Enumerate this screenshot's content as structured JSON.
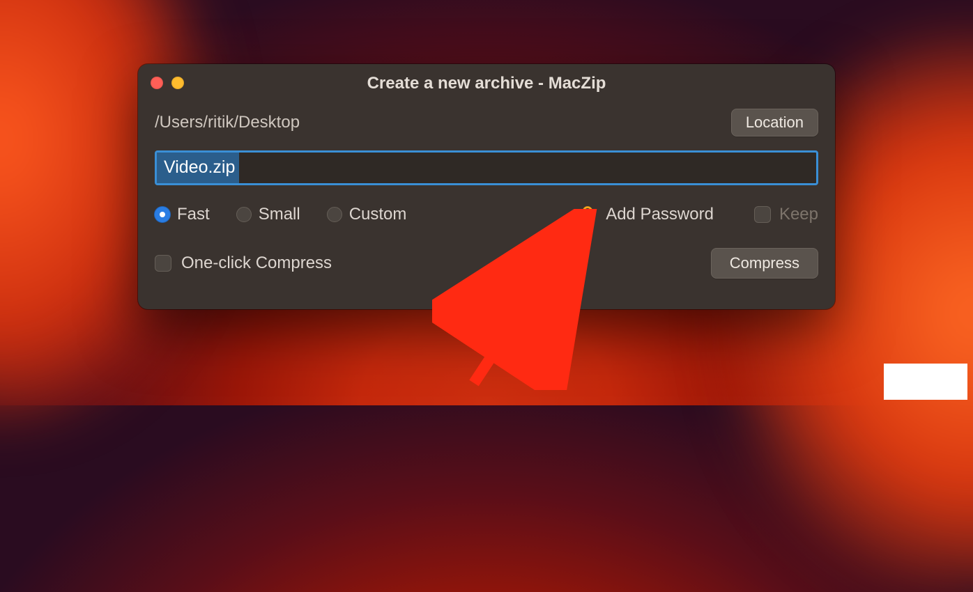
{
  "window": {
    "title": "Create a new archive - MacZip",
    "path": "/Users/ritik/Desktop",
    "location_button": "Location",
    "filename": "Video.zip",
    "compression": {
      "fast": "Fast",
      "small": "Small",
      "custom": "Custom",
      "selected": "fast"
    },
    "add_password": "Add Password",
    "keep": "Keep",
    "one_click": "One-click Compress",
    "compress_button": "Compress"
  },
  "colors": {
    "accent": "#2a7de3",
    "focus_ring": "#3a8fd6",
    "lock": "#f4a51d",
    "arrow": "#ff2a12"
  }
}
